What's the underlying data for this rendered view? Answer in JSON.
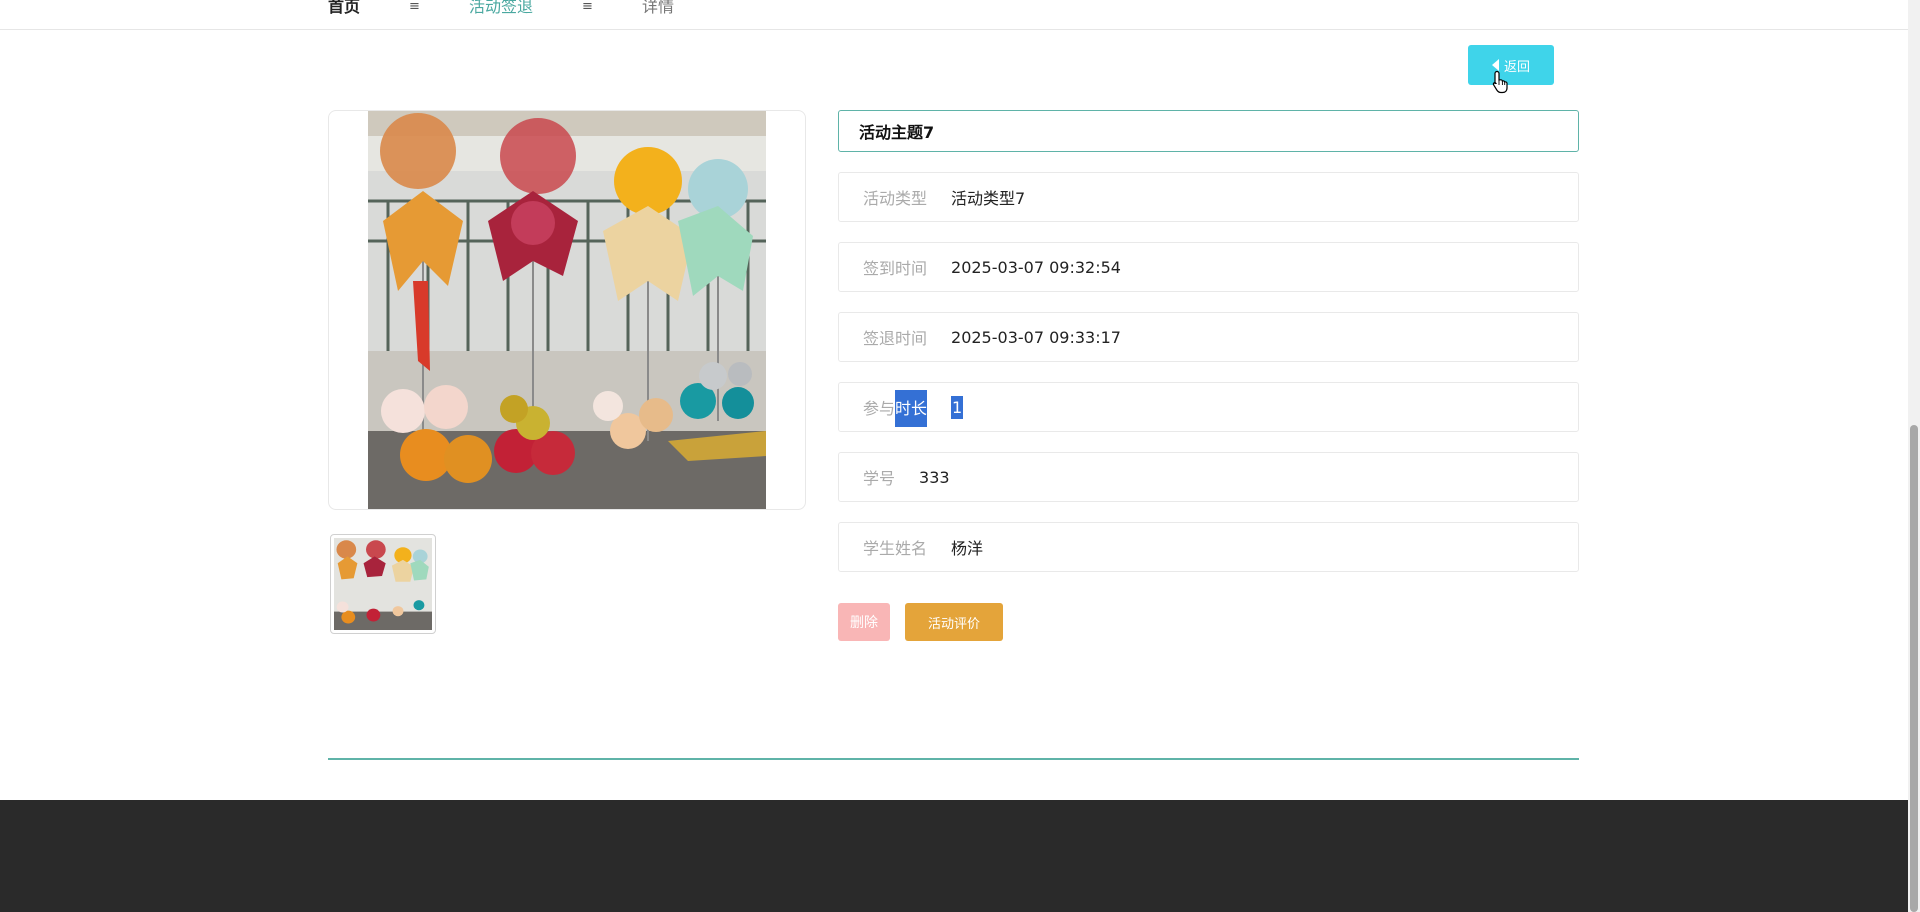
{
  "breadcrumb": {
    "home": "首页",
    "separator": "≡",
    "section": "活动签退",
    "current": "详情"
  },
  "back_button": {
    "label": "返回"
  },
  "detail": {
    "title": "活动主题7",
    "fields": [
      {
        "label": "活动类型",
        "value": "活动类型7"
      },
      {
        "label": "签到时间",
        "value": "2025-03-07 09:32:54"
      },
      {
        "label": "签退时间",
        "value": "2025-03-07 09:33:17"
      },
      {
        "label_plain": "参与",
        "label_highlight": "时长",
        "value": "1"
      },
      {
        "label": "学号",
        "value": "333"
      },
      {
        "label": "学生姓名",
        "value": "杨洋"
      }
    ]
  },
  "actions": {
    "delete_label": "删除",
    "review_label": "活动评价"
  },
  "colors": {
    "accent": "#4aa8a0",
    "back_button": "#3fd4ea",
    "delete_button": "#f9b6b6",
    "review_button": "#e4a43a",
    "selection": "#3470d5",
    "footer": "#2a2a2a"
  },
  "icons": [
    "caret-left-icon",
    "pointer-cursor-icon"
  ]
}
